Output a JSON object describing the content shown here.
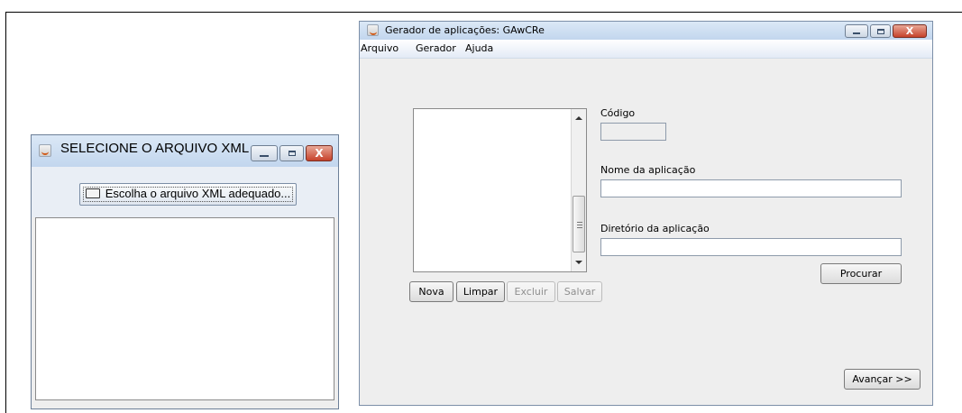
{
  "left_window": {
    "title": "SELECIONE O ARQUIVO XML",
    "choose_button_label": "Escolha o arquivo XML adequado...",
    "choose_button_icon": "folder-open-icon",
    "controls": {
      "minimize_icon": "minimize-icon",
      "maximize_icon": "maximize-icon",
      "close_icon": "close-icon",
      "close_glyph": "X"
    }
  },
  "right_window": {
    "title": "Gerador de aplicações: GAwCRe",
    "menu": [
      "Arquivo",
      "Gerador",
      "Ajuda"
    ],
    "list_buttons": {
      "new": "Nova",
      "clear": "Limpar",
      "delete": "Excluir",
      "save": "Salvar"
    },
    "fields": {
      "code_label": "Código",
      "code_value": "",
      "app_name_label": "Nome da aplicação",
      "app_name_value": "",
      "app_dir_label": "Diretório da aplicação",
      "app_dir_value": ""
    },
    "browse_button": "Procurar",
    "next_button": "Avançar >>",
    "controls": {
      "close_glyph": "X"
    },
    "colors": {
      "titlebar_top": "#dbe8f6",
      "titlebar_bottom": "#c2d6ee",
      "close_button": "#c6422b"
    }
  }
}
